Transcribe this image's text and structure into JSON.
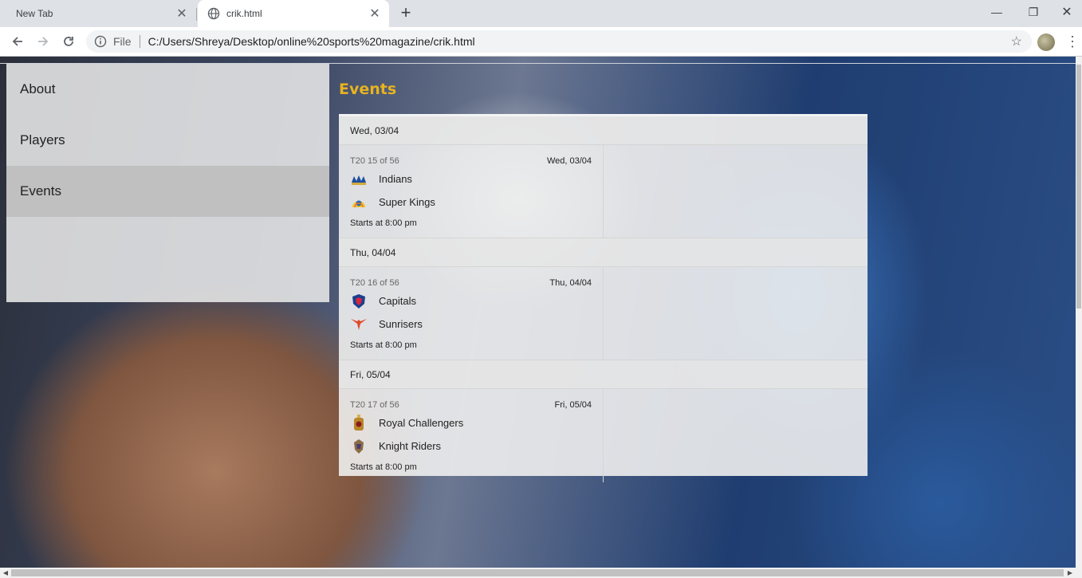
{
  "browser": {
    "tabs": [
      {
        "title": "New Tab",
        "close": "✕"
      },
      {
        "title": "crik.html",
        "close": "✕"
      }
    ],
    "new_tab": "+",
    "window_controls": {
      "minimize": "—",
      "maximize": "❐",
      "close": "✕"
    },
    "address": {
      "scheme": "File",
      "url": "C:/Users/Shreya/Desktop/online%20sports%20magazine/crik.html"
    },
    "icons": {
      "back": "back-arrow-icon",
      "forward": "forward-arrow-icon",
      "reload": "reload-icon",
      "info": "info-icon",
      "star": "star-icon",
      "menu": "kebab-menu-icon"
    }
  },
  "sidenav": {
    "items": [
      {
        "label": "About"
      },
      {
        "label": "Players"
      },
      {
        "label": "Events"
      }
    ],
    "active_index": 2
  },
  "page": {
    "heading": "Events",
    "heading_color": "#e8b320"
  },
  "events": [
    {
      "day": "Wed, 03/04",
      "series": "T20 15 of 56",
      "date": "Wed, 03/04",
      "team1": "Indians",
      "team2": "Super Kings",
      "start": "Starts at 8:00 pm"
    },
    {
      "day": "Thu, 04/04",
      "series": "T20 16 of 56",
      "date": "Thu, 04/04",
      "team1": "Capitals",
      "team2": "Sunrisers",
      "start": "Starts at 8:00 pm"
    },
    {
      "day": "Fri, 05/04",
      "series": "T20 17 of 56",
      "date": "Fri, 05/04",
      "team1": "Royal Challengers",
      "team2": "Knight Riders",
      "start": "Starts at 8:00 pm"
    }
  ]
}
